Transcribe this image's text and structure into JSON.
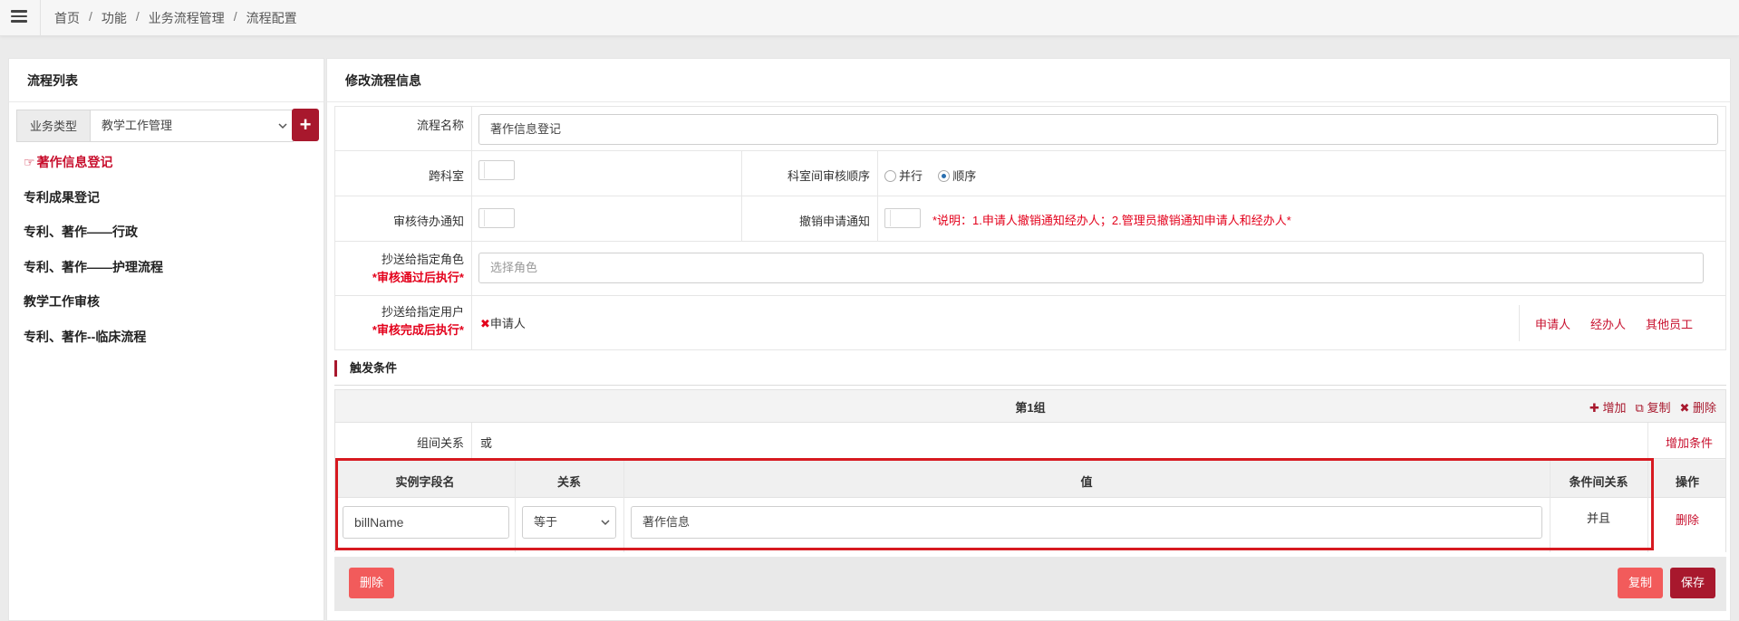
{
  "breadcrumb": [
    "首页",
    "功能",
    "业务流程管理",
    "流程配置"
  ],
  "left_panel": {
    "title": "流程列表",
    "type_label": "业务类型",
    "type_value": "教学工作管理",
    "add_symbol": "+",
    "flows": [
      {
        "label": "著作信息登记",
        "active": true
      },
      {
        "label": "专利成果登记"
      },
      {
        "label": "专利、著作——行政"
      },
      {
        "label": "专利、著作——护理流程"
      },
      {
        "label": "教学工作审核"
      },
      {
        "label": "专利、著作--临床流程"
      }
    ]
  },
  "right_panel": {
    "title": "修改流程信息",
    "fields": {
      "flow_name_label": "流程名称",
      "flow_name_value": "著作信息登记",
      "cross_dept_label": "跨科室",
      "dept_order_label": "科室间审核顺序",
      "order_parallel": "并行",
      "order_sequence": "顺序",
      "pending_notice_label": "审核待办通知",
      "cancel_notice_label": "撤销申请通知",
      "cancel_note": "*说明：1.申请人撤销通知经办人；2.管理员撤销通知申请人和经办人*",
      "cc_role_label": "抄送给指定角色",
      "cc_role_sub": "*审核通过后执行*",
      "cc_role_placeholder": "选择角色",
      "cc_user_label": "抄送给指定用户",
      "cc_user_sub": "*审核完成后执行*",
      "cc_user_tag": "申请人",
      "cc_user_links": [
        "申请人",
        "经办人",
        "其他员工"
      ]
    },
    "trigger": {
      "section_title": "触发条件",
      "group_title": "第1组",
      "group_actions": [
        "增加",
        "复制",
        "删除"
      ],
      "group_rel_label": "组间关系",
      "group_rel_value": "或",
      "add_condition": "增加条件",
      "columns": [
        "实例字段名",
        "关系",
        "值",
        "条件间关系",
        "操作"
      ],
      "row": {
        "field": "billName",
        "relation": "等于",
        "value": "著作信息",
        "logic": "并且",
        "action": "删除"
      }
    },
    "buttons": {
      "delete": "删除",
      "copy": "复制",
      "save": "保存"
    }
  }
}
